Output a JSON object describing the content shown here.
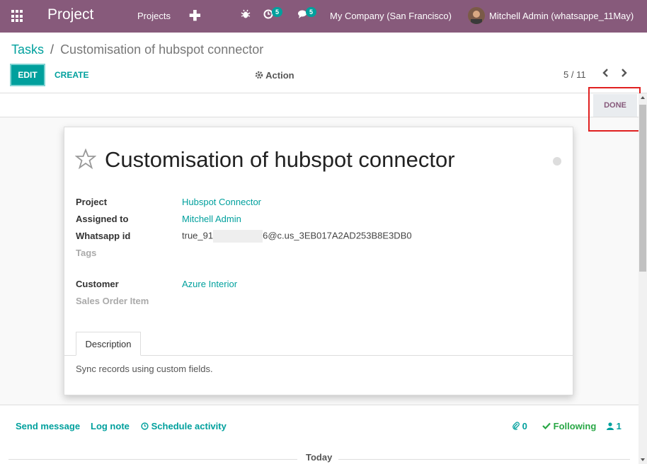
{
  "navbar": {
    "brand": "Project",
    "menu_projects": "Projects",
    "plus_symbol": "✚",
    "activity_count": "5",
    "messages_count": "5",
    "company": "My Company (San Francisco)",
    "user": "Mitchell Admin (whatsappe_11May)",
    "icons": [
      "apps-icon",
      "plus-icon",
      "bug-icon",
      "activity-icon",
      "chat-icon",
      "avatar"
    ]
  },
  "control_panel": {
    "breadcrumb_parent": "Tasks",
    "breadcrumb_sep": "/",
    "breadcrumb_current": "Customisation of hubspot connector",
    "edit_label": "EDIT",
    "create_label": "CREATE",
    "action_label": "Action",
    "pager": "5 / 11"
  },
  "statusbar": {
    "done_label": "DONE"
  },
  "form": {
    "title": "Customisation of hubspot connector",
    "fields": {
      "project_label": "Project",
      "project_value": "Hubspot Connector",
      "assigned_label": "Assigned to",
      "assigned_value": "Mitchell Admin",
      "whatsapp_label": "Whatsapp id",
      "whatsapp_prefix": "true_91",
      "whatsapp_suffix": "6@c.us_3EB017A2AD253B8E3DB0",
      "tags_label": "Tags",
      "customer_label": "Customer",
      "customer_value": "Azure Interior",
      "sales_order_label": "Sales Order Item"
    },
    "tab_description": "Description",
    "description_text": "Sync records using custom fields."
  },
  "chatter": {
    "send_message": "Send message",
    "log_note": "Log note",
    "schedule_activity": "Schedule activity",
    "attachments_count": "0",
    "following_label": "Following",
    "followers_count": "1",
    "today_label": "Today"
  },
  "colors": {
    "navbar": "#875a7b",
    "accent": "#00a09d",
    "following": "#28a745",
    "highlight": "#e02020"
  }
}
